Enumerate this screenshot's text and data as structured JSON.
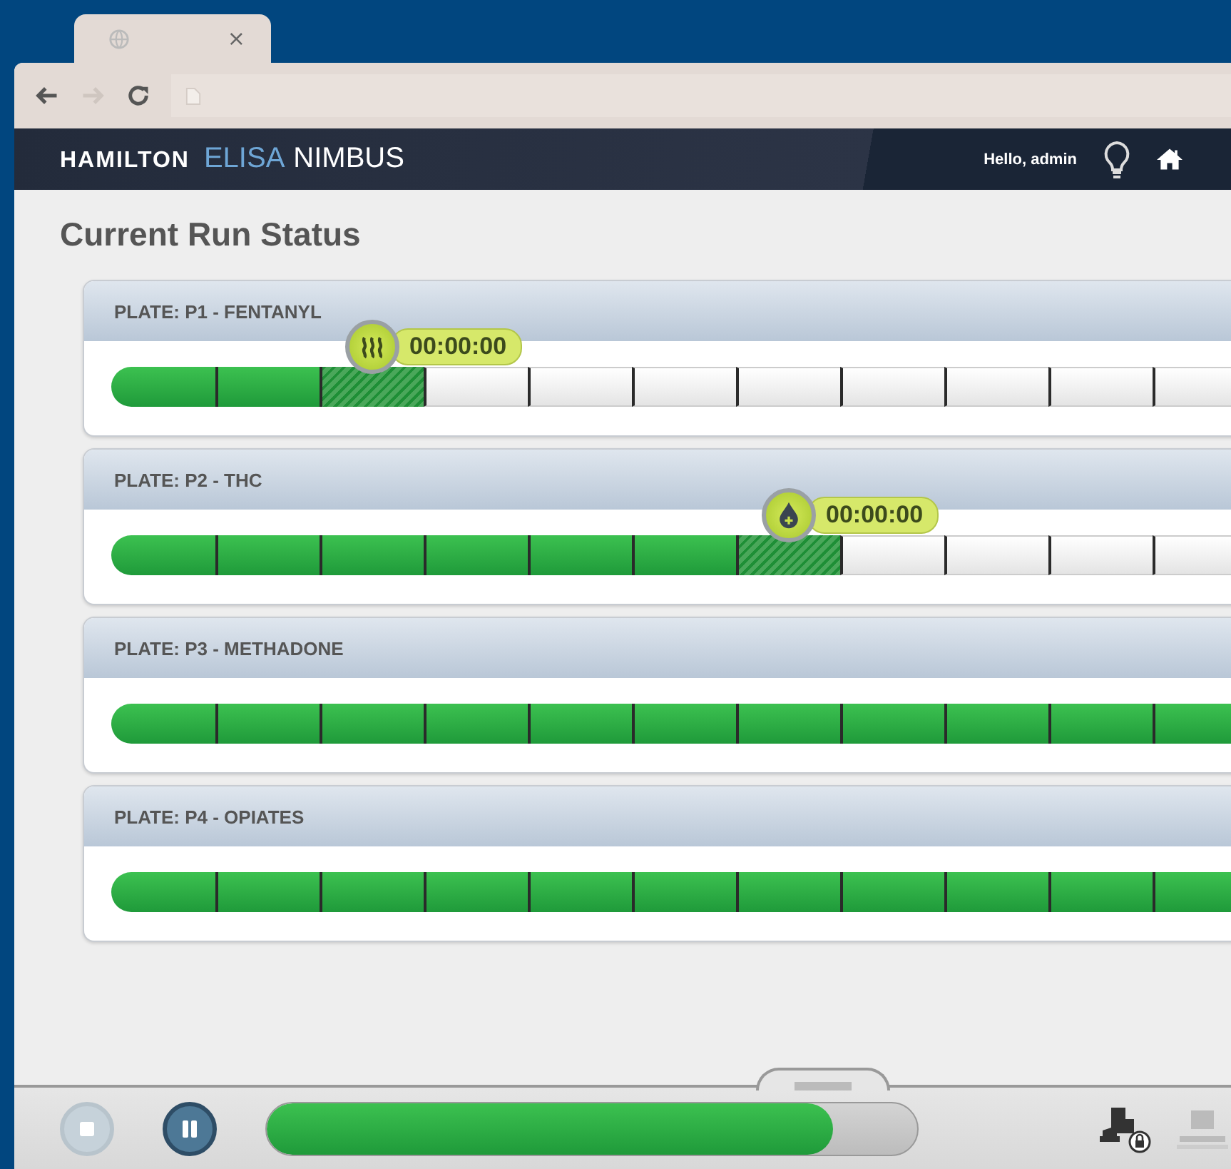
{
  "browser": {
    "tab_close": "×",
    "back": {
      "disabled": false
    },
    "forward": {
      "disabled": true
    }
  },
  "header": {
    "brand": "HAMILTON",
    "product_1": "ELISA",
    "product_2": "NIMBUS",
    "greeting": "Hello, admin"
  },
  "title": "Current Run Status",
  "plates": [
    {
      "label": "PLATE: P1 - FENTANYL",
      "marker": {
        "kind": "heat",
        "time": "00:00:00"
      },
      "segments": [
        {
          "kind": "done"
        },
        {
          "kind": "done"
        },
        {
          "kind": "active"
        },
        {
          "kind": "pending"
        },
        {
          "kind": "pending"
        },
        {
          "kind": "pending"
        },
        {
          "kind": "pending"
        },
        {
          "kind": "pending"
        },
        {
          "kind": "pending"
        },
        {
          "kind": "pending"
        },
        {
          "kind": "pending"
        }
      ]
    },
    {
      "label": "PLATE: P2 - THC",
      "marker": {
        "kind": "drop",
        "time": "00:00:00"
      },
      "segments": [
        {
          "kind": "done"
        },
        {
          "kind": "done"
        },
        {
          "kind": "done"
        },
        {
          "kind": "done"
        },
        {
          "kind": "done"
        },
        {
          "kind": "done"
        },
        {
          "kind": "active"
        },
        {
          "kind": "pending"
        },
        {
          "kind": "pending"
        },
        {
          "kind": "pending"
        },
        {
          "kind": "pending"
        }
      ]
    },
    {
      "label": "PLATE: P3 - METHADONE",
      "segments": [
        {
          "kind": "done"
        },
        {
          "kind": "done"
        },
        {
          "kind": "done"
        },
        {
          "kind": "done"
        },
        {
          "kind": "done"
        },
        {
          "kind": "done"
        },
        {
          "kind": "done"
        },
        {
          "kind": "done"
        },
        {
          "kind": "done"
        },
        {
          "kind": "done"
        },
        {
          "kind": "done"
        }
      ]
    },
    {
      "label": "PLATE: P4 - OPIATES",
      "segments": [
        {
          "kind": "done"
        },
        {
          "kind": "done"
        },
        {
          "kind": "done"
        },
        {
          "kind": "done"
        },
        {
          "kind": "done"
        },
        {
          "kind": "done"
        },
        {
          "kind": "done"
        },
        {
          "kind": "done"
        },
        {
          "kind": "done"
        },
        {
          "kind": "done"
        },
        {
          "kind": "done"
        }
      ]
    }
  ],
  "footer": {
    "stop_button": {
      "disabled": true
    },
    "pause_button": {
      "disabled": false
    },
    "run_progress": {
      "level": 0.87
    }
  }
}
